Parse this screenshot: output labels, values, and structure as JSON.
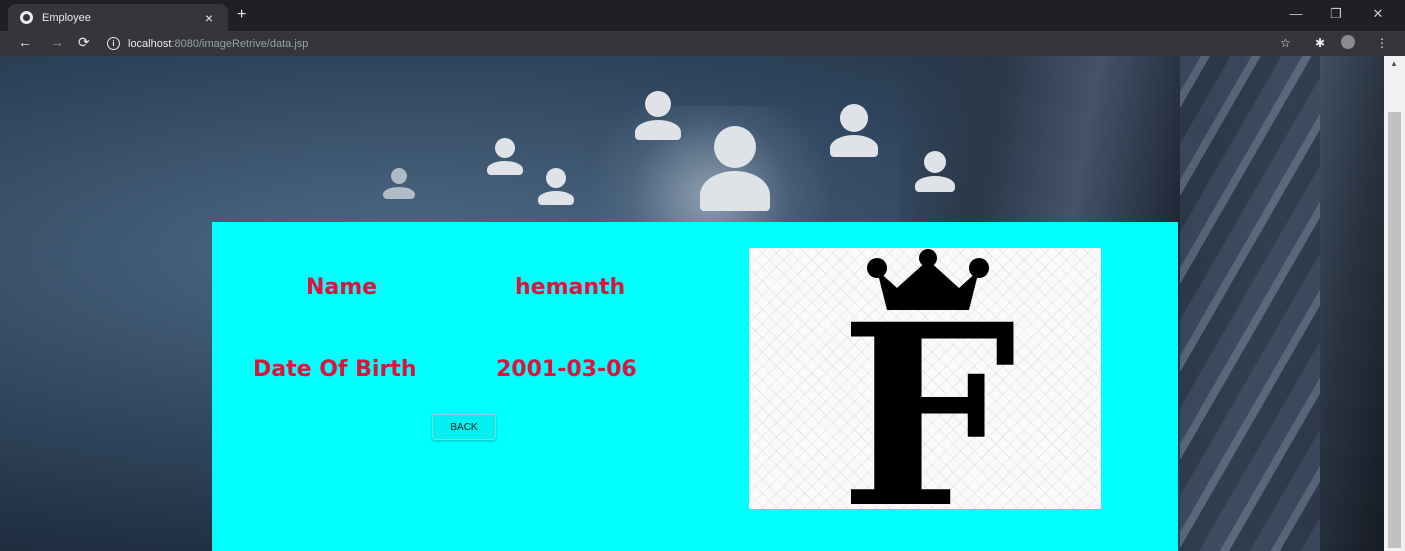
{
  "browser": {
    "tab_title": "Employee",
    "tab_close": "×",
    "new_tab": "+",
    "url_host": "localhost",
    "url_path": ":8080/imageRetrive/data.jsp",
    "info_glyph": "i",
    "icons": {
      "back": "arrow-left-icon",
      "forward": "arrow-right-icon",
      "reload": "reload-icon",
      "bookmark": "star-icon",
      "extensions": "puzzle-icon",
      "profile": "avatar-icon",
      "menu": "kebab-menu-icon"
    }
  },
  "employee": {
    "name_label": "Name",
    "name_value": "hemanth",
    "dob_label": "Date Of Birth",
    "dob_value": "2001-03-06",
    "back_label": "BACK",
    "photo_letter": "F"
  },
  "colors": {
    "panel": "#00ffff",
    "label_text": "#dc143c"
  }
}
